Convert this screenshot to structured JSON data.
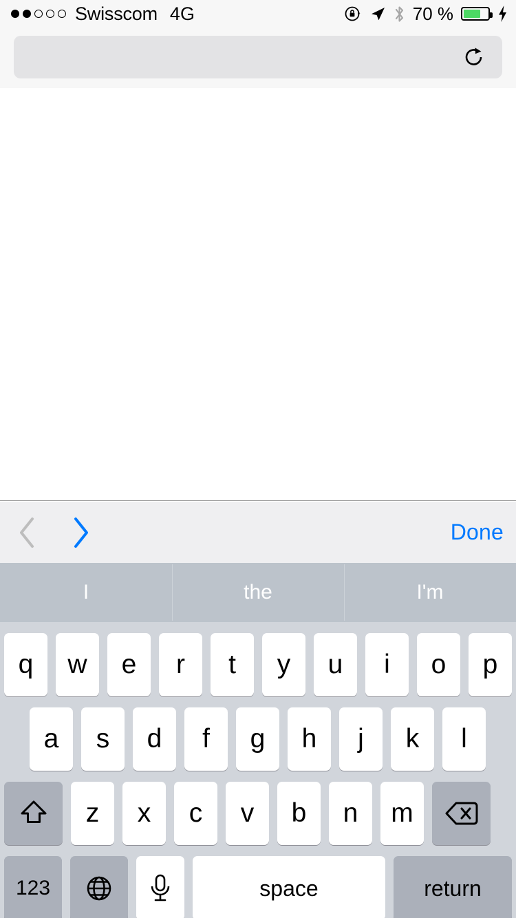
{
  "status_bar": {
    "signal_dots_total": 5,
    "signal_dots_filled": 2,
    "carrier": "Swisscom",
    "network": "4G",
    "battery_percent": "70 %",
    "battery_level": 70,
    "icons": [
      "rotation-lock-icon",
      "location-arrow-icon",
      "bluetooth-icon",
      "battery-icon",
      "charging-bolt-icon"
    ]
  },
  "browser": {
    "url_value": "",
    "url_placeholder": "",
    "reload_icon": "reload-icon"
  },
  "accessory_bar": {
    "prev_icon": "chevron-left-icon",
    "next_icon": "chevron-right-icon",
    "prev_enabled": false,
    "next_enabled": true,
    "done_label": "Done",
    "accent_color": "#007AFF",
    "disabled_color": "#BDBDBD"
  },
  "predictions": [
    {
      "label": "I"
    },
    {
      "label": "the"
    },
    {
      "label": "I'm"
    }
  ],
  "keyboard": {
    "layout": "lowercase-qwerty",
    "row1": [
      "q",
      "w",
      "e",
      "r",
      "t",
      "y",
      "u",
      "i",
      "o",
      "p"
    ],
    "row2": [
      "a",
      "s",
      "d",
      "f",
      "g",
      "h",
      "j",
      "k",
      "l"
    ],
    "row3": [
      "z",
      "x",
      "c",
      "v",
      "b",
      "n",
      "m"
    ],
    "shift_icon": "shift-icon",
    "backspace_icon": "backspace-icon",
    "numbers_label": "123",
    "globe_icon": "globe-icon",
    "dictation_icon": "microphone-icon",
    "space_label": "space",
    "return_label": "return",
    "background_color": "#D1D5DB",
    "key_color": "#FFFFFF",
    "modifier_key_color": "#ABB0BA"
  }
}
